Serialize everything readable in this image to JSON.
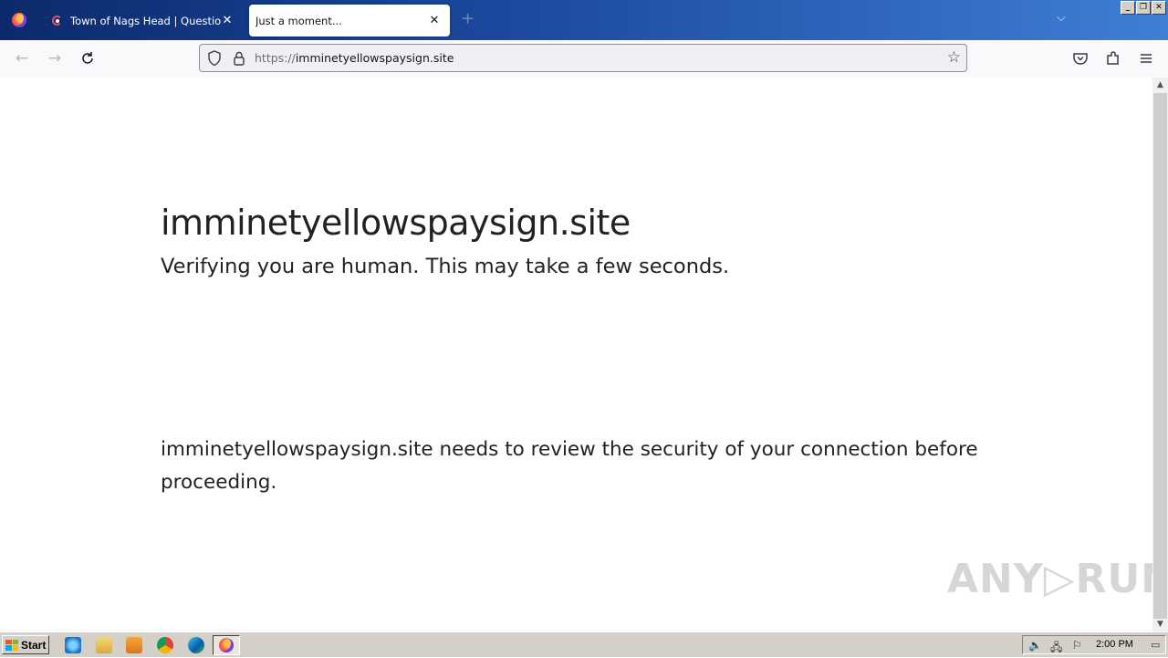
{
  "browser": {
    "tabs": [
      {
        "title": "Town of Nags Head | QuestionScope",
        "active": false
      },
      {
        "title": "Just a moment...",
        "active": true
      }
    ],
    "new_tab_label": "+",
    "url_scheme": "https://",
    "url_host": "imminetyellowspaysign.site"
  },
  "page": {
    "site_title": "imminetyellowspaysign.site",
    "verify_text": "Verifying you are human. This may take a few seconds.",
    "review_text": "imminetyellowspaysign.site needs to review the security of your connection before proceeding."
  },
  "watermark": "ANY▷RUN",
  "taskbar": {
    "start_label": "Start",
    "clock": "2:00 PM"
  },
  "colors": {
    "tabstrip_start": "#0b2a6b",
    "tabstrip_end": "#3f7fd6",
    "text": "#222222"
  }
}
